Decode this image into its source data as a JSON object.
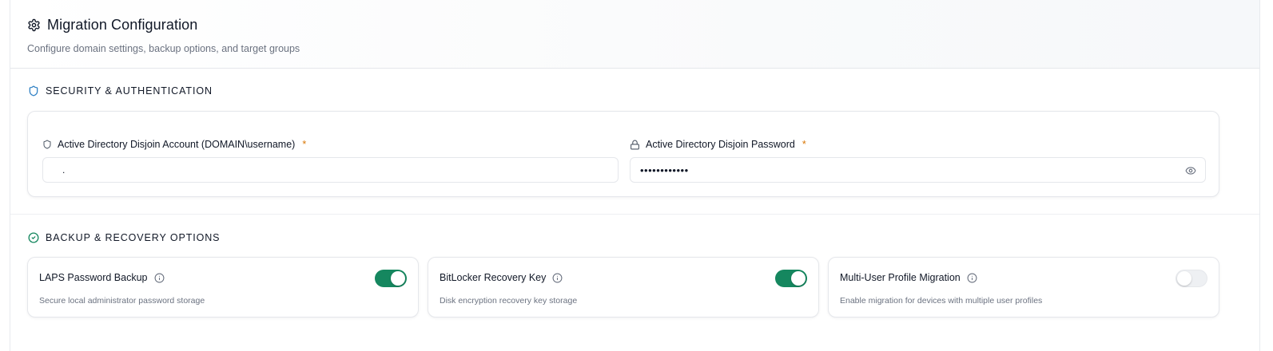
{
  "header": {
    "title": "Migration Configuration",
    "subtitle": "Configure domain settings, backup options, and target groups",
    "icon": "gear-icon"
  },
  "security": {
    "section_title": "SECURITY & AUTHENTICATION",
    "section_icon": "shield-icon",
    "accent_color": "#2f80c4",
    "account_field": {
      "label": "Active Directory Disjoin Account (DOMAIN\\username)",
      "required_mark": "*",
      "value": ".",
      "icon": "shield-outline-icon"
    },
    "password_field": {
      "label": "Active Directory Disjoin Password",
      "required_mark": "*",
      "value": "••••••••••••",
      "icon": "lock-icon",
      "toggle_icon": "eye-icon"
    }
  },
  "backup": {
    "section_title": "BACKUP & RECOVERY OPTIONS",
    "section_icon": "check-circle-icon",
    "accent_color": "#15875f",
    "options": [
      {
        "title": "LAPS Password Backup",
        "description": "Secure local administrator password storage",
        "enabled": true,
        "info_icon": "info-icon"
      },
      {
        "title": "BitLocker Recovery Key",
        "description": "Disk encryption recovery key storage",
        "enabled": true,
        "info_icon": "info-icon"
      },
      {
        "title": "Multi-User Profile Migration",
        "description": "Enable migration for devices with multiple user profiles",
        "enabled": false,
        "info_icon": "info-icon"
      }
    ]
  },
  "colors": {
    "toggle_on": "#15875f",
    "toggle_off": "#eef0f3",
    "required": "#d97706"
  }
}
